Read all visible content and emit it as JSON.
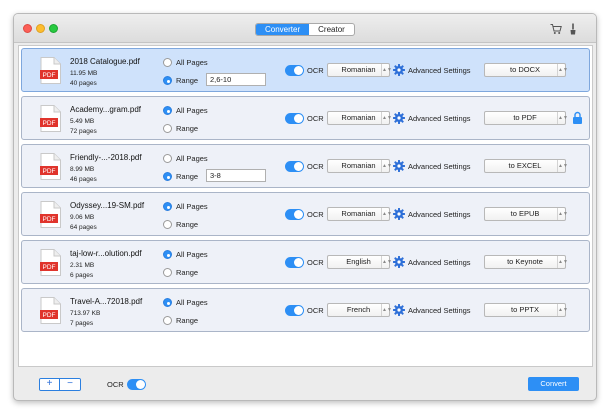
{
  "toolbar": {
    "tabs": [
      {
        "label": "Converter",
        "active": true
      },
      {
        "label": "Creator",
        "active": false
      }
    ],
    "icons": [
      "cart-icon",
      "brush-icon"
    ]
  },
  "options": {
    "all_pages": "All Pages",
    "range": "Range",
    "ocr": "OCR",
    "advanced": "Advanced Settings"
  },
  "files": [
    {
      "name": "2018 Catalogue.pdf",
      "size": "11.95 MB",
      "pages": "40 pages",
      "page_mode": "range",
      "range": "2,6-10",
      "ocr": true,
      "language": "Romanian",
      "format": "to DOCX",
      "locked": false,
      "selected": true
    },
    {
      "name": "Academy...gram.pdf",
      "size": "5.49 MB",
      "pages": "72 pages",
      "page_mode": "all",
      "range": "",
      "ocr": true,
      "language": "Romanian",
      "format": "to PDF",
      "locked": true,
      "selected": false
    },
    {
      "name": "Friendly-...-2018.pdf",
      "size": "8.99 MB",
      "pages": "46 pages",
      "page_mode": "range",
      "range": "3-8",
      "ocr": true,
      "language": "Romanian",
      "format": "to EXCEL",
      "locked": false,
      "selected": false
    },
    {
      "name": "Odyssey...19-SM.pdf",
      "size": "9.06 MB",
      "pages": "64 pages",
      "page_mode": "all",
      "range": "",
      "ocr": true,
      "language": "Romanian",
      "format": "to EPUB",
      "locked": false,
      "selected": false
    },
    {
      "name": "taj-low-r...olution.pdf",
      "size": "2.31 MB",
      "pages": "6 pages",
      "page_mode": "all",
      "range": "",
      "ocr": true,
      "language": "English",
      "format": "to Keynote",
      "locked": false,
      "selected": false
    },
    {
      "name": "Travel-A...72018.pdf",
      "size": "713.97 KB",
      "pages": "7 pages",
      "page_mode": "all",
      "range": "",
      "ocr": true,
      "language": "French",
      "format": "to PPTX",
      "locked": false,
      "selected": false
    }
  ],
  "bottom": {
    "add_label": "+",
    "remove_label": "−",
    "ocr_label": "OCR",
    "ocr_on": true,
    "convert_label": "Convert"
  },
  "colors": {
    "accent": "#2d8ff5",
    "row_bg": "#eef1f8",
    "row_selected_bg": "#cfe2fb",
    "pdf_red": "#e0342c"
  }
}
